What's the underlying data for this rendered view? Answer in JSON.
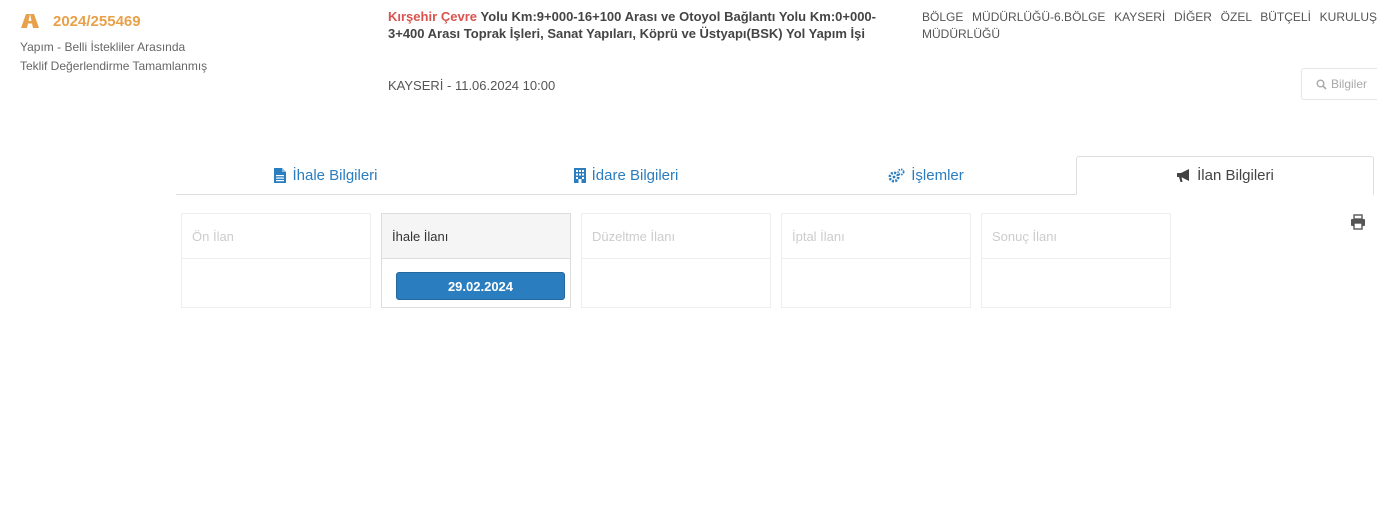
{
  "tender": {
    "ikn": "2024/255469",
    "status_line1": "Yapım - Belli İstekliler Arasında",
    "status_line2": "Teklif Değerlendirme Tamamlanmış",
    "title_city": "Kırşehir Çevre",
    "title_rest": " Yolu Km:9+000-16+100 Arası ve Otoyol Bağlantı Yolu Km:0+000-3+400 Arası Toprak İşleri, Sanat Yapıları, Köprü ve Üstyapı(BSK) Yol Yapım İşi",
    "location": "KAYSERİ - 11.06.2024 10:00",
    "authority": "BÖLGE MÜDÜRLÜĞÜ-6.BÖLGE KAYSERİ DİĞER ÖZEL BÜTÇELİ KURULUŞ MÜDÜRLÜĞÜ"
  },
  "info_button": {
    "label": "Bilgiler",
    "icon": "search-icon"
  },
  "tabs": [
    {
      "label": "İhale Bilgileri",
      "icon": "document-icon",
      "active": false
    },
    {
      "label": "İdare Bilgileri",
      "icon": "building-icon",
      "active": false
    },
    {
      "label": "İşlemler",
      "icon": "gears-icon",
      "active": false
    },
    {
      "label": "İlan Bilgileri",
      "icon": "megaphone-icon",
      "active": true
    }
  ],
  "print": {
    "icon": "print-icon"
  },
  "announcements": [
    {
      "label": "Ön İlan",
      "active": false
    },
    {
      "label": "İhale İlanı",
      "active": true,
      "date": "29.02.2024"
    },
    {
      "label": "Düzeltme İlanı",
      "active": false
    },
    {
      "label": "İptal İlanı",
      "active": false
    },
    {
      "label": "Sonuç İlanı",
      "active": false
    }
  ],
  "colors": {
    "accent": "#2a7dbf",
    "ikn": "#e8a14a",
    "city": "#d9534f"
  }
}
